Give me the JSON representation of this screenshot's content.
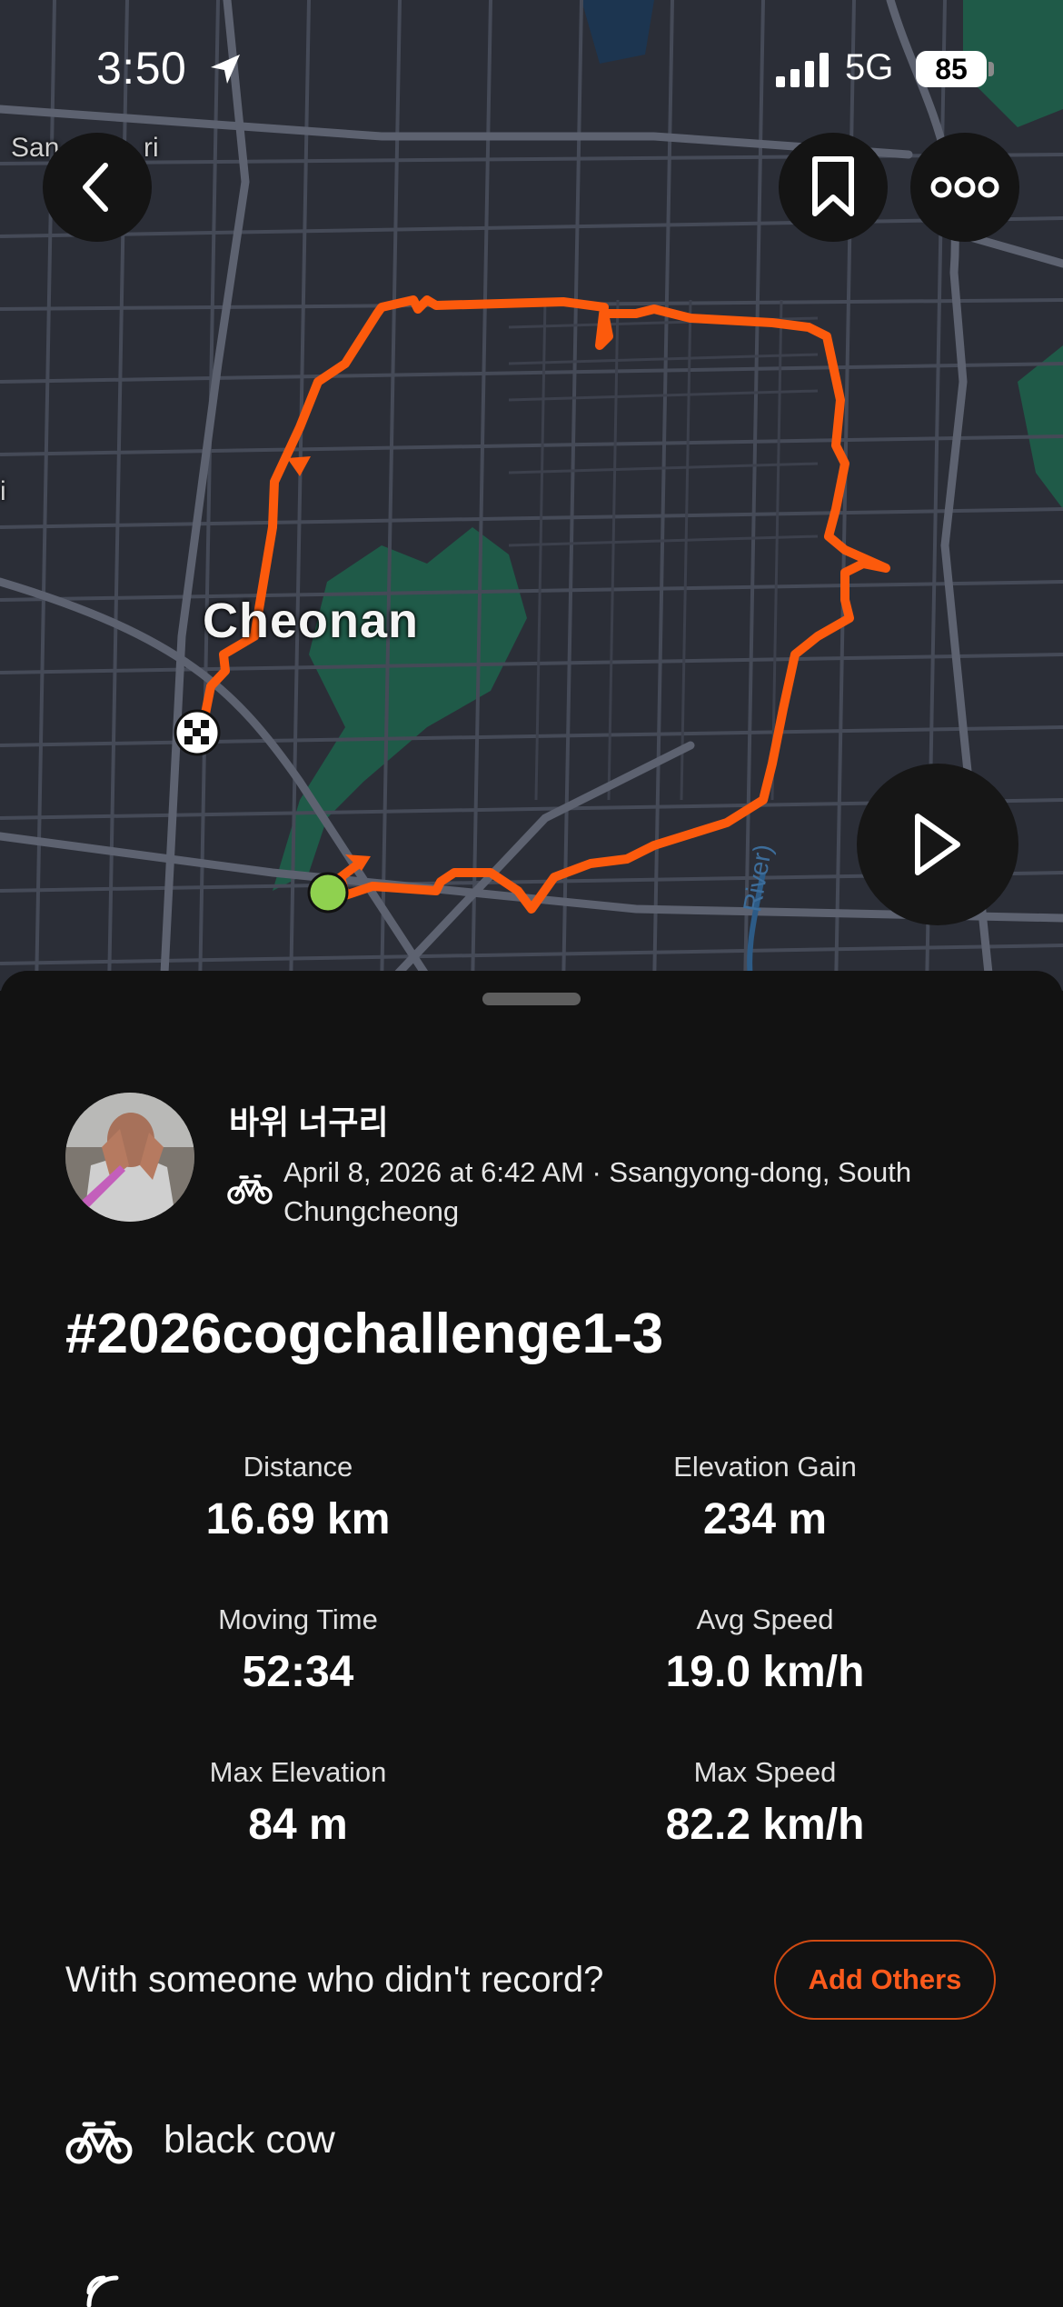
{
  "status_bar": {
    "time": "3:50",
    "network": "5G",
    "battery": "85"
  },
  "map": {
    "place_labels": [
      "Cheonan",
      "San",
      "ri",
      "i",
      "River)"
    ],
    "route_color": "#fc5a0c",
    "start_color": "#8fd14f"
  },
  "activity": {
    "athlete_name": "바위 너구리",
    "meta": "April 8, 2026 at 6:42 AM · Ssangyong-dong, South Chungcheong",
    "title": "#2026cogchallenge1-3",
    "stats": [
      {
        "label": "Distance",
        "value": "16.69 km"
      },
      {
        "label": "Elevation Gain",
        "value": "234 m"
      },
      {
        "label": "Moving Time",
        "value": "52:34"
      },
      {
        "label": "Avg Speed",
        "value": "19.0 km/h"
      },
      {
        "label": "Max Elevation",
        "value": "84 m"
      },
      {
        "label": "Max Speed",
        "value": "82.2 km/h"
      }
    ],
    "with_prompt": "With someone who didn't record?",
    "add_others_label": "Add Others",
    "gear_name": "black cow"
  },
  "colors": {
    "accent": "#fc5a1c",
    "background": "#121212"
  }
}
